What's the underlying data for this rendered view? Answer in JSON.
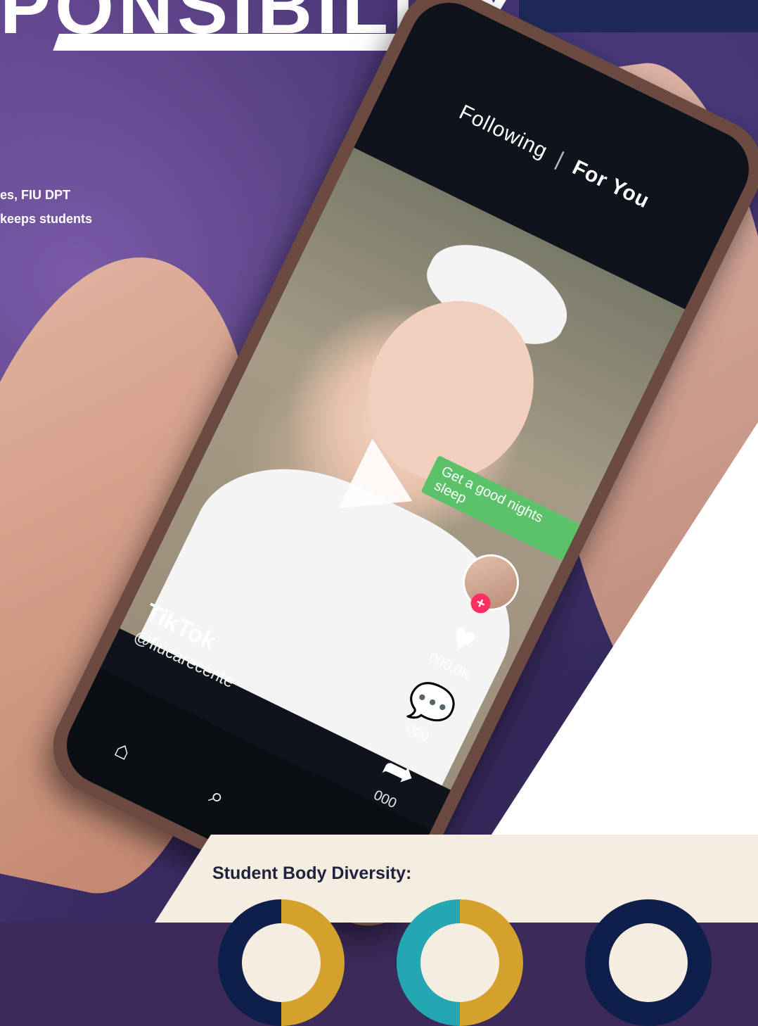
{
  "headline": "PONSIBILITY",
  "intro": {
    "line1": "es, FIU DPT",
    "line2": "keeps students"
  },
  "tiktok": {
    "tabs": {
      "following": "Following",
      "for_you": "For You",
      "separator": "|"
    },
    "caption": "Get a good nights sleep",
    "rail": {
      "likes_count": "000,0K",
      "comments_count": "000",
      "shares_count": "000"
    },
    "overlay": {
      "logo_text": "TikTok",
      "username": "@fiucarecente"
    },
    "icons": {
      "play": "play-icon",
      "heart": "heart-icon",
      "comment": "comment-icon",
      "share": "share-icon",
      "home": "home-icon",
      "search": "search-icon",
      "music": "music-icon",
      "plus": "plus-icon"
    }
  },
  "stats_panel": {
    "title": "Student Body Diversity:"
  },
  "colors": {
    "accent_gold": "#d4a22c",
    "navy": "#0d1f4a",
    "teal": "#25a7b3",
    "caption_green": "#5bc26a",
    "follow_pink": "#ff2e63"
  }
}
